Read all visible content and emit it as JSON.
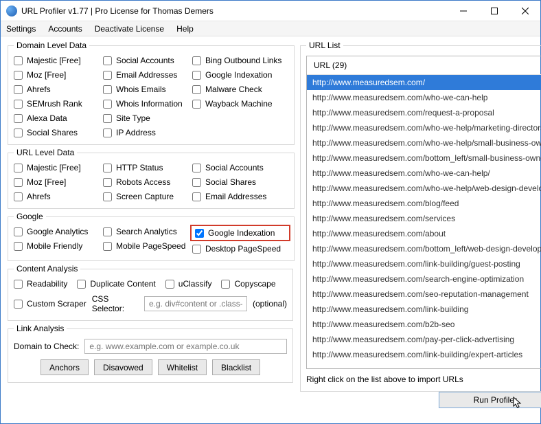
{
  "window": {
    "title": "URL Profiler v1.77 | Pro License for Thomas Demers"
  },
  "menu": [
    "Settings",
    "Accounts",
    "Deactivate License",
    "Help"
  ],
  "groups": {
    "domain": {
      "legend": "Domain Level Data",
      "cols": [
        [
          "Majestic [Free]",
          "Moz [Free]",
          "Ahrefs",
          "SEMrush Rank",
          "Alexa Data",
          "Social Shares"
        ],
        [
          "Social Accounts",
          "Email Addresses",
          "Whois Emails",
          "Whois Information",
          "Site Type",
          "IP Address"
        ],
        [
          "Bing Outbound Links",
          "Google Indexation",
          "Malware Check",
          "Wayback Machine"
        ]
      ]
    },
    "url": {
      "legend": "URL Level Data",
      "cols": [
        [
          "Majestic [Free]",
          "Moz [Free]",
          "Ahrefs"
        ],
        [
          "HTTP Status",
          "Robots Access",
          "Screen Capture"
        ],
        [
          "Social Accounts",
          "Social Shares",
          "Email Addresses"
        ]
      ]
    },
    "google": {
      "legend": "Google",
      "cols": [
        [
          "Google Analytics",
          "Mobile Friendly"
        ],
        [
          "Search Analytics",
          "Mobile PageSpeed"
        ],
        [
          "Google Indexation",
          "Desktop PageSpeed"
        ]
      ],
      "checked": {
        "col": 2,
        "row": 0
      }
    },
    "content": {
      "legend": "Content Analysis",
      "row": [
        "Readability",
        "Duplicate Content",
        "uClassify",
        "Copyscape"
      ],
      "scraper_label": "Custom Scraper",
      "css_label": "CSS Selector:",
      "css_placeholder": "e.g. div#content or .class-na",
      "optional": "(optional)"
    },
    "link": {
      "legend": "Link Analysis",
      "domain_label": "Domain to Check:",
      "domain_placeholder": "e.g. www.example.com or example.co.uk",
      "buttons": [
        "Anchors",
        "Disavowed",
        "Whitelist",
        "Blacklist"
      ]
    }
  },
  "urlpanel": {
    "legend": "URL List",
    "header": "URL (29)",
    "items": [
      "http://www.measuredsem.com/",
      "http://www.measuredsem.com/who-we-can-help",
      "http://www.measuredsem.com/request-a-proposal",
      "http://www.measuredsem.com/who-we-help/marketing-directors",
      "http://www.measuredsem.com/who-we-help/small-business-own",
      "http://www.measuredsem.com/bottom_left/small-business-owne",
      "http://www.measuredsem.com/who-we-can-help/",
      "http://www.measuredsem.com/who-we-help/web-design-develo",
      "http://www.measuredsem.com/blog/feed",
      "http://www.measuredsem.com/services",
      "http://www.measuredsem.com/about",
      "http://www.measuredsem.com/bottom_left/web-design-developr",
      "http://www.measuredsem.com/link-building/guest-posting",
      "http://www.measuredsem.com/search-engine-optimization",
      "http://www.measuredsem.com/seo-reputation-management",
      "http://www.measuredsem.com/link-building",
      "http://www.measuredsem.com/b2b-seo",
      "http://www.measuredsem.com/pay-per-click-advertising",
      "http://www.measuredsem.com/link-building/expert-articles"
    ],
    "selected": 0,
    "hint": "Right click on the list above to import URLs"
  },
  "run": "Run Profiler"
}
